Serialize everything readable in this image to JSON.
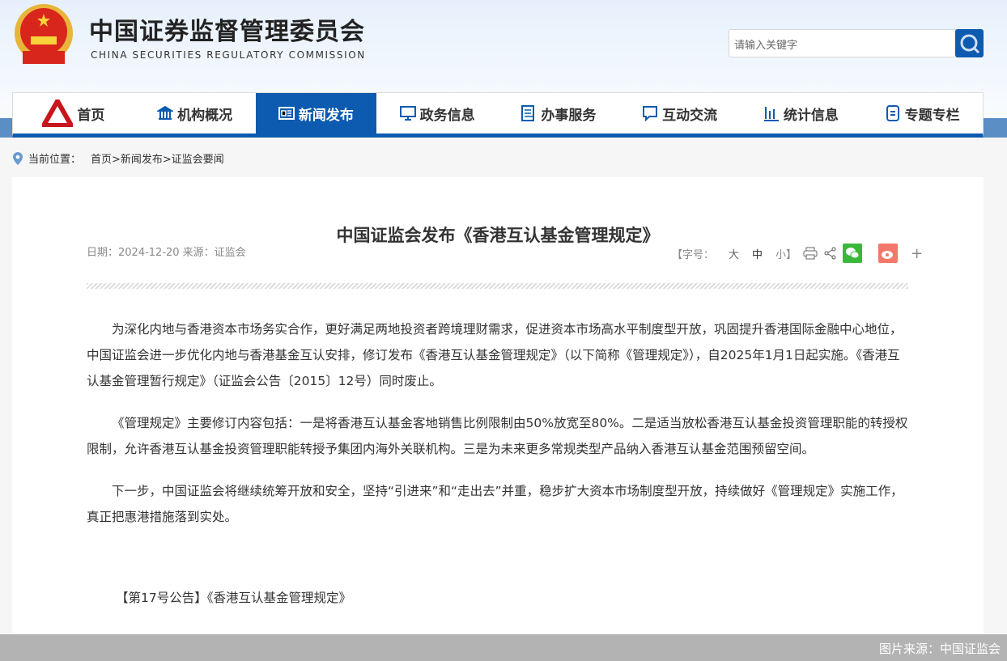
{
  "header": {
    "title": "中国证券监督管理委员会",
    "subtitle": "CHINA SECURITIES REGULATORY COMMISSION",
    "search_placeholder": "请输入关键字"
  },
  "nav": [
    "首页",
    "机构概况",
    "新闻发布",
    "政务信息",
    "办事服务",
    "互动交流",
    "统计信息",
    "专题专栏"
  ],
  "breadcrumb": {
    "label": "当前位置：",
    "path": "首页>新闻发布>证监会要闻"
  },
  "article": {
    "title": "中国证监会发布《香港互认基金管理规定》",
    "meta": "日期：2024-12-20 来源：证监会",
    "font_label": "【字号：",
    "font_large": "大",
    "font_medium": "中",
    "font_small": "小】",
    "paragraphs": [
      "为深化内地与香港资本市场务实合作，更好满足两地投资者跨境理财需求，促进资本市场高水平制度型开放，巩固提升香港国际金融中心地位，中国证监会进一步优化内地与香港基金互认安排，修订发布《香港互认基金管理规定》（以下简称《管理规定》），自2025年1月1日起实施。《香港互认基金管理暂行规定》（证监会公告〔2015〕12号）同时废止。",
      "《管理规定》主要修订内容包括：一是将香港互认基金客地销售比例限制由50%放宽至80%。二是适当放松香港互认基金投资管理职能的转授权限制，允许香港互认基金投资管理职能转授予集团内海外关联机构。三是为未来更多常规类型产品纳入香港互认基金范围预留空间。",
      "下一步，中国证监会将继续统筹开放和安全，坚持“引进来”和“走出去”并重，稳步扩大资本市场制度型开放，持续做好《管理规定》实施工作，真正把惠港措施落到实处。"
    ],
    "attachment": "【第17号公告】《香港互认基金管理规定》"
  },
  "footer": "图片来源：中国证监会"
}
